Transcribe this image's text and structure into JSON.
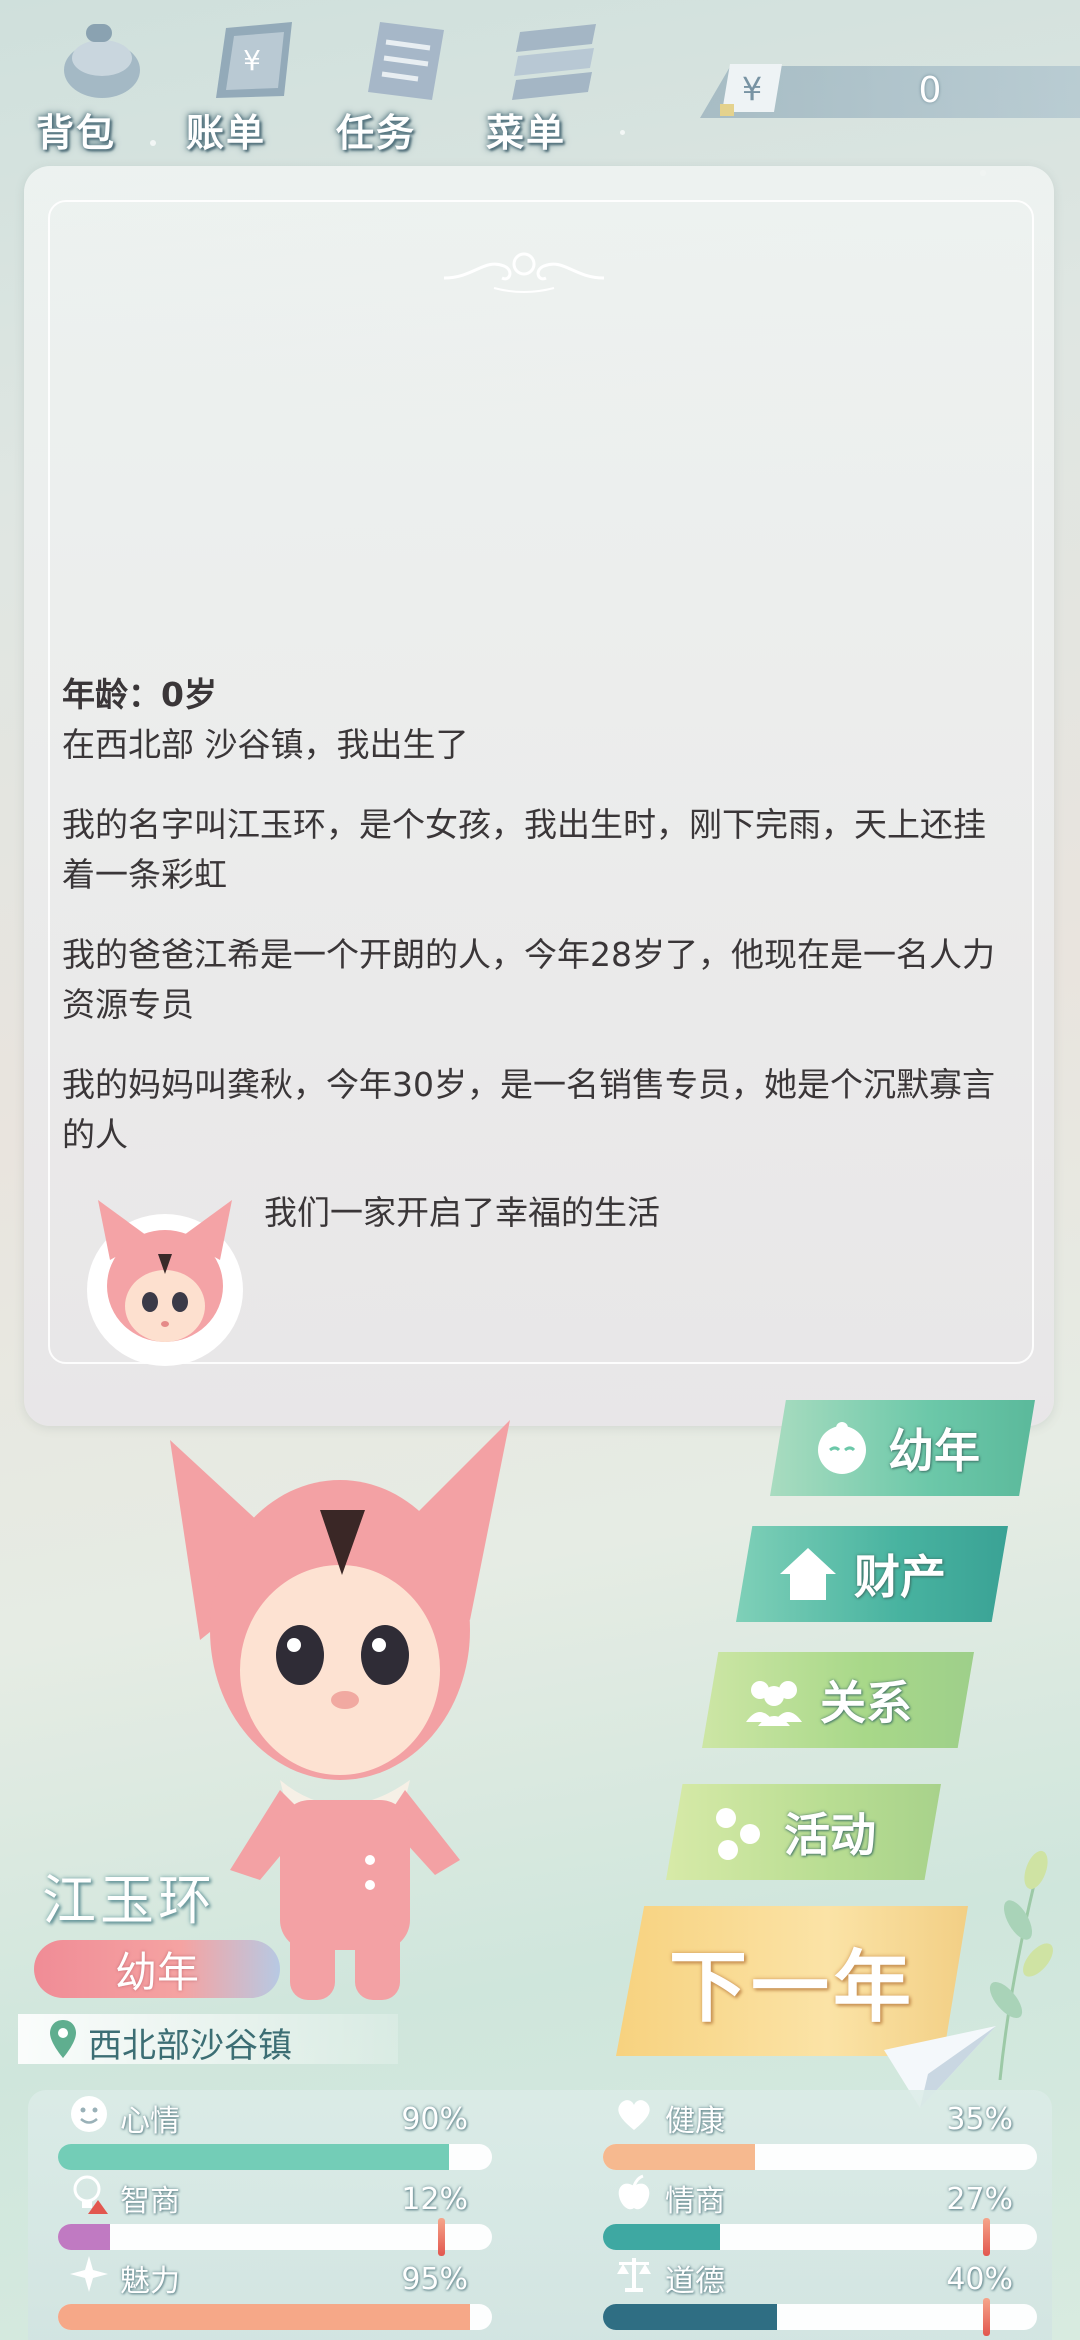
{
  "topbar": {
    "nav": [
      {
        "label": "背包",
        "icon": "backpack-icon"
      },
      {
        "label": "账单",
        "icon": "bill-icon"
      },
      {
        "label": "任务",
        "icon": "task-icon"
      },
      {
        "label": "菜单",
        "icon": "menu-icon"
      }
    ],
    "money": {
      "currency_symbol": "¥",
      "value": "0"
    }
  },
  "story": {
    "age_line": "年龄：0岁",
    "paragraphs": [
      "在西北部 沙谷镇，我出生了",
      "我的名字叫江玉环，是个女孩，我出生时，刚下完雨，天上还挂着一条彩虹",
      "我的爸爸江希是一个开朗的人，今年28岁了，他现在是一名人力资源专员",
      "我的妈妈叫龚秋，今年30岁，是一名销售专员，她是个沉默寡言的人"
    ],
    "family_line": "我们一家开启了幸福的生活"
  },
  "side_buttons": {
    "youth": "幼年",
    "property": "财产",
    "relations": "关系",
    "activity": "活动",
    "next_year": "下一年"
  },
  "character": {
    "name": "江玉环",
    "stage": "幼年",
    "location": "西北部沙谷镇"
  },
  "stats": [
    {
      "name": "心情",
      "value": "90%",
      "fraction": 0.9,
      "color": "#73cdb7",
      "icon": "smiley-icon"
    },
    {
      "name": "健康",
      "value": "35%",
      "fraction": 0.35,
      "color": "#f6b98f",
      "icon": "heart-icon"
    },
    {
      "name": "智商",
      "value": "12%",
      "fraction": 0.12,
      "color": "#c07ac2",
      "icon": "lightbulb-icon",
      "warning": true
    },
    {
      "name": "情商",
      "value": "27%",
      "fraction": 0.27,
      "color": "#3ea8a2",
      "icon": "apple-icon",
      "warning": true
    },
    {
      "name": "魅力",
      "value": "95%",
      "fraction": 0.95,
      "color": "#f6a888",
      "icon": "sparkle-icon"
    },
    {
      "name": "道德",
      "value": "40%",
      "fraction": 0.4,
      "color": "#2f6e83",
      "icon": "scales-icon",
      "warning": true
    }
  ]
}
